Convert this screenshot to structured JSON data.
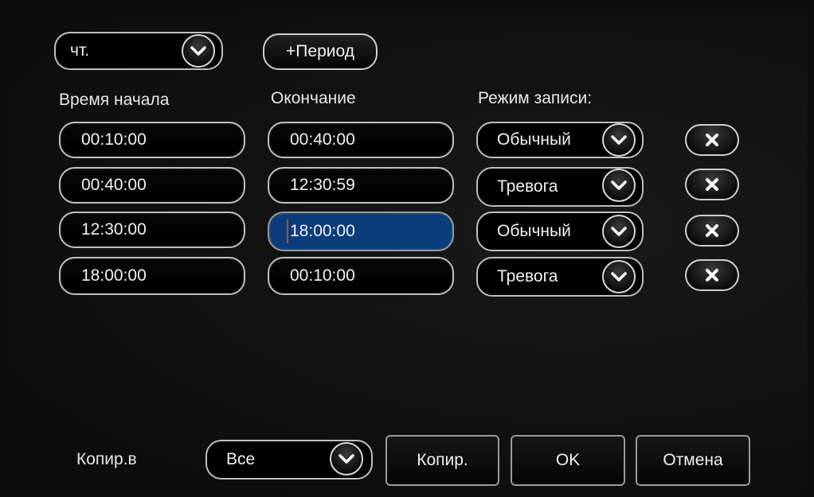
{
  "day_select": {
    "value": "чт."
  },
  "add_period_label": "+Период",
  "headers": {
    "start": "Время начала",
    "end": "Окончание",
    "mode": "Режим записи:"
  },
  "rows": [
    {
      "start": "00:10:00",
      "end": "00:40:00",
      "mode": "Обычный"
    },
    {
      "start": "00:40:00",
      "end": "12:30:59",
      "mode": "Тревога"
    },
    {
      "start": "12:30:00",
      "end": "18:00:00",
      "mode": "Обычный"
    },
    {
      "start": "18:00:00",
      "end": "00:10:00",
      "mode": "Тревога"
    }
  ],
  "footer": {
    "copy_to_label": "Копир.в",
    "copy_target": "Все",
    "copy_button": "Копир.",
    "ok_button": "OK",
    "cancel_button": "Отмена"
  },
  "icons": {
    "dropdown": "chevron-down-icon",
    "delete": "close-icon"
  }
}
